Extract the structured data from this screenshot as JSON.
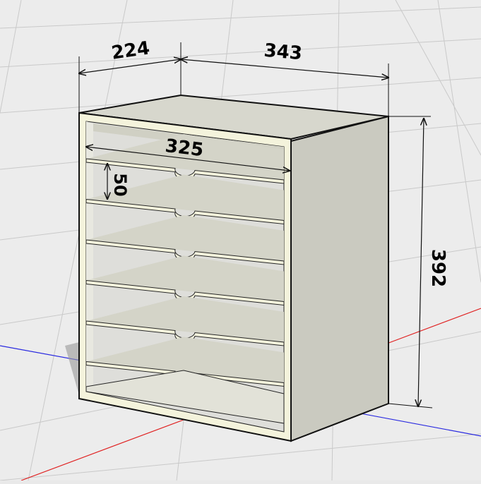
{
  "dimensions": {
    "depth": "224",
    "width": "343",
    "inner_width": "325",
    "shelf_spacing": "50",
    "height": "392"
  },
  "colors": {
    "background": "#ececec",
    "grid_line": "#c8c8c8",
    "panel_edge": "#f7f5dc",
    "panel_face": "#d9d9cf",
    "panel_side": "#c9c9bf",
    "shelf_top": "#d2d2c6",
    "outline": "#1a1a1a",
    "axis_red": "#e02020",
    "axis_blue": "#2020e0",
    "dimension_line": "#111111"
  },
  "shelf_count": 6
}
